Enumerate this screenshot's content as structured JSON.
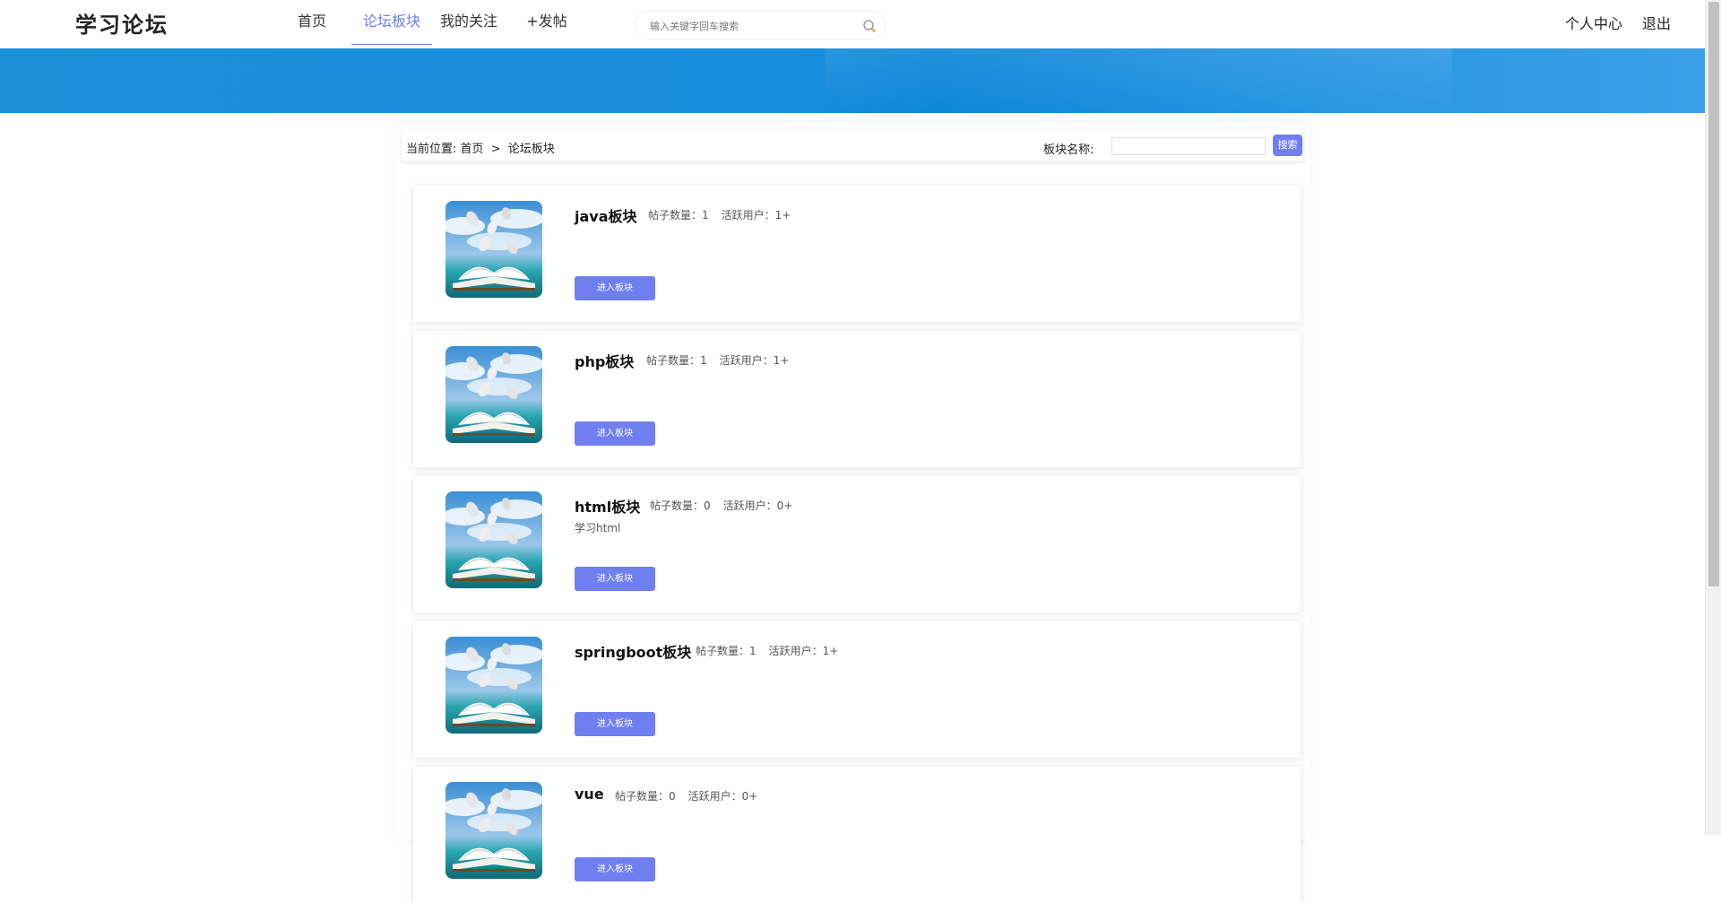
{
  "header": {
    "logo": "学习论坛",
    "nav": [
      "首页",
      "论坛板块",
      "我的关注",
      "+发帖"
    ],
    "search_placeholder": "输入关键字回车搜索",
    "user_center": "个人中心",
    "logout": "退出"
  },
  "breadcrumb": {
    "prefix": "当前位置:",
    "home": "首页",
    "separator": ">",
    "current": "论坛板块"
  },
  "filter": {
    "label": "板块名称:",
    "button": "搜索"
  },
  "cards": [
    {
      "title": "java板块",
      "posts": "帖子数量：1",
      "users": "活跃用户：1+",
      "desc": "",
      "button": "进入板块"
    },
    {
      "title": "php板块",
      "posts": "帖子数量：1",
      "users": "活跃用户：1+",
      "desc": "",
      "button": "进入板块"
    },
    {
      "title": "html板块",
      "posts": "帖子数量：0",
      "users": "活跃用户：0+",
      "desc": "学习html",
      "button": "进入板块"
    },
    {
      "title": "springboot板块",
      "posts": "帖子数量：1",
      "users": "活跃用户：1+",
      "desc": "",
      "button": "进入板块"
    },
    {
      "title": "vue",
      "posts": "帖子数量：0",
      "users": "活跃用户：0+",
      "desc": "",
      "button": "进入板块"
    }
  ],
  "colors": {
    "accent": "#6f7ff0",
    "banner": "#1a8ede"
  }
}
